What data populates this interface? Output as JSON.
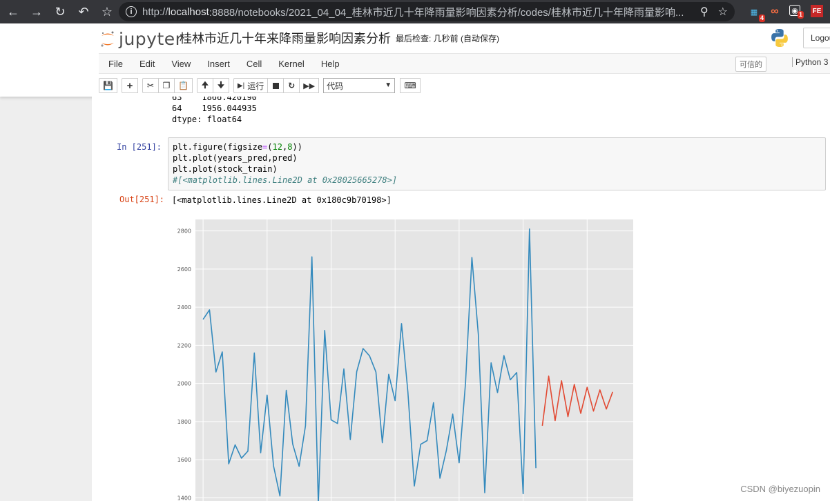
{
  "browser": {
    "url_scheme": "http://",
    "url_host": "localhost",
    "url_rest": ":8888/notebooks/2021_04_04_桂林市近几十年降雨量影响因素分析/codes/桂林市近几十年降雨量影响...",
    "extensions": [
      {
        "label": "4",
        "badge": "4"
      },
      {
        "label": "∞",
        "badge": ""
      },
      {
        "label": "1",
        "badge": "1"
      },
      {
        "label": "FE",
        "badge": ""
      }
    ]
  },
  "header": {
    "logo_text": "jupyter",
    "notebook_title": "桂林市近几十年来降雨量影响因素分析",
    "checkpoint": "最后检查: 几秒前  (自动保存)",
    "logout_label": "Logou"
  },
  "menubar": {
    "items": [
      "File",
      "Edit",
      "View",
      "Insert",
      "Cell",
      "Kernel",
      "Help"
    ],
    "trusted": "可信的",
    "kernel": "Python 3"
  },
  "toolbar": {
    "run_label": "运行",
    "cell_type": "代码"
  },
  "cells": {
    "prev_output": [
      "63    1866.420190",
      "64    1956.044935",
      "dtype: float64"
    ],
    "in_prompt": "In  [251]:",
    "out_prompt": "Out[251]:",
    "code": {
      "l1_a": "plt.figure(figsize",
      "l1_op": "=",
      "l1_b": "(",
      "l1_n1": "12",
      "l1_c": ",",
      "l1_n2": "8",
      "l1_d": "))",
      "l2": "plt.plot(years_pred,pred)",
      "l3": "plt.plot(stock_train)",
      "l4": "#[<matplotlib.lines.Line2D at 0x28025665278>]"
    },
    "output_text": "[<matplotlib.lines.Line2D at 0x180c9b70198>]"
  },
  "watermark": "CSDN @biyezuopin",
  "chart_data": {
    "type": "line",
    "ylim": [
      1340,
      2860
    ],
    "xlim": [
      -1.2,
      67.2
    ],
    "yticks": [
      1400,
      1600,
      1800,
      2000,
      2200,
      2400,
      2600,
      2800
    ],
    "grid": true,
    "background": "#e5e5e5",
    "series": [
      {
        "color": "#348abd",
        "x": [
          0,
          1,
          2,
          3,
          4,
          5,
          6,
          7,
          8,
          9,
          10,
          11,
          12,
          13,
          14,
          15,
          16,
          17,
          18,
          19,
          20,
          21,
          22,
          23,
          24,
          25,
          26,
          27,
          28,
          29,
          30,
          31,
          32,
          33,
          34,
          35,
          36,
          37,
          38,
          39,
          40,
          41,
          42,
          43,
          44,
          45,
          46,
          47,
          48,
          49,
          50,
          51,
          52,
          53
        ],
        "values": [
          2336,
          2386,
          2060,
          2165,
          1578,
          1678,
          1608,
          1645,
          2160,
          1636,
          1939,
          1568,
          1410,
          1964,
          1682,
          1565,
          1778,
          2664,
          1369,
          2278,
          1809,
          1790,
          2076,
          1705,
          2062,
          2183,
          2145,
          2060,
          1689,
          2048,
          1910,
          2314,
          1955,
          1462,
          1681,
          1700,
          1899,
          1503,
          1647,
          1839,
          1584,
          2004,
          2661,
          2258,
          1427,
          2108,
          1952,
          2146,
          2019,
          2057,
          1422,
          2810,
          1556,
          null
        ]
      },
      {
        "color": "#e24a33",
        "x": [
          53,
          54,
          55,
          56,
          57,
          58,
          59,
          60,
          61,
          62,
          63,
          64
        ],
        "values": [
          1778,
          2038,
          1805,
          2014,
          1826,
          1995,
          1843,
          1980,
          1855,
          1966,
          1866,
          1956
        ]
      }
    ]
  }
}
